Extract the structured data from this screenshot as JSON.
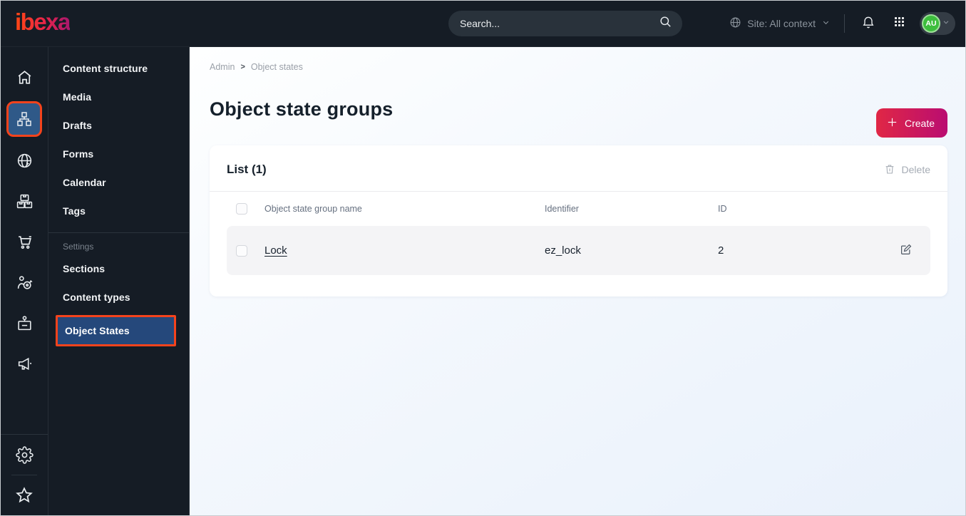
{
  "topbar": {
    "logo": "ibexa",
    "search_placeholder": "Search...",
    "site_selector": "Site: All context",
    "avatar_initials": "AU"
  },
  "icons": {
    "rail": [
      "home-icon",
      "content-structure-icon",
      "site-globe-icon",
      "product-catalog-icon",
      "cart-icon",
      "customer-target-icon",
      "corporate-badge-icon",
      "megaphone-icon",
      "gear-icon",
      "star-icon"
    ],
    "rail_selected": "content-structure-icon",
    "topbar": [
      "globe-icon",
      "bell-icon",
      "app-grid-icon",
      "chevron-down-icon",
      "search-icon"
    ],
    "table": [
      "trash-icon",
      "edit-icon",
      "checkbox"
    ]
  },
  "menu": {
    "items": [
      "Content structure",
      "Media",
      "Drafts",
      "Forms",
      "Calendar",
      "Tags"
    ],
    "section_label": "Settings",
    "settings_items": [
      "Sections",
      "Content types",
      "Object States"
    ],
    "selected_item": "Object States"
  },
  "main": {
    "breadcrumb": [
      "Admin",
      "Object states"
    ],
    "breadcrumb_separator": ">",
    "title": "Object state groups",
    "create_button": "Create",
    "list": {
      "title": "List (1)",
      "delete_button": "Delete",
      "columns": [
        "Object state group name",
        "Identifier",
        "ID"
      ],
      "rows": [
        {
          "name": "Lock",
          "identifier": "ez_lock",
          "id": "2"
        }
      ]
    }
  },
  "colors": {
    "topbar_bg": "#151c25",
    "accent_red": "#e02745",
    "accent_magenta": "#ba0d71",
    "annotation_orange": "#f4431c",
    "selected_blue": "#2f5988",
    "selected_menu_blue": "#25487b",
    "avatar_green": "#3dbe3d",
    "main_bg_tint": "#e9f1fb",
    "row_bg": "#f4f4f6"
  }
}
